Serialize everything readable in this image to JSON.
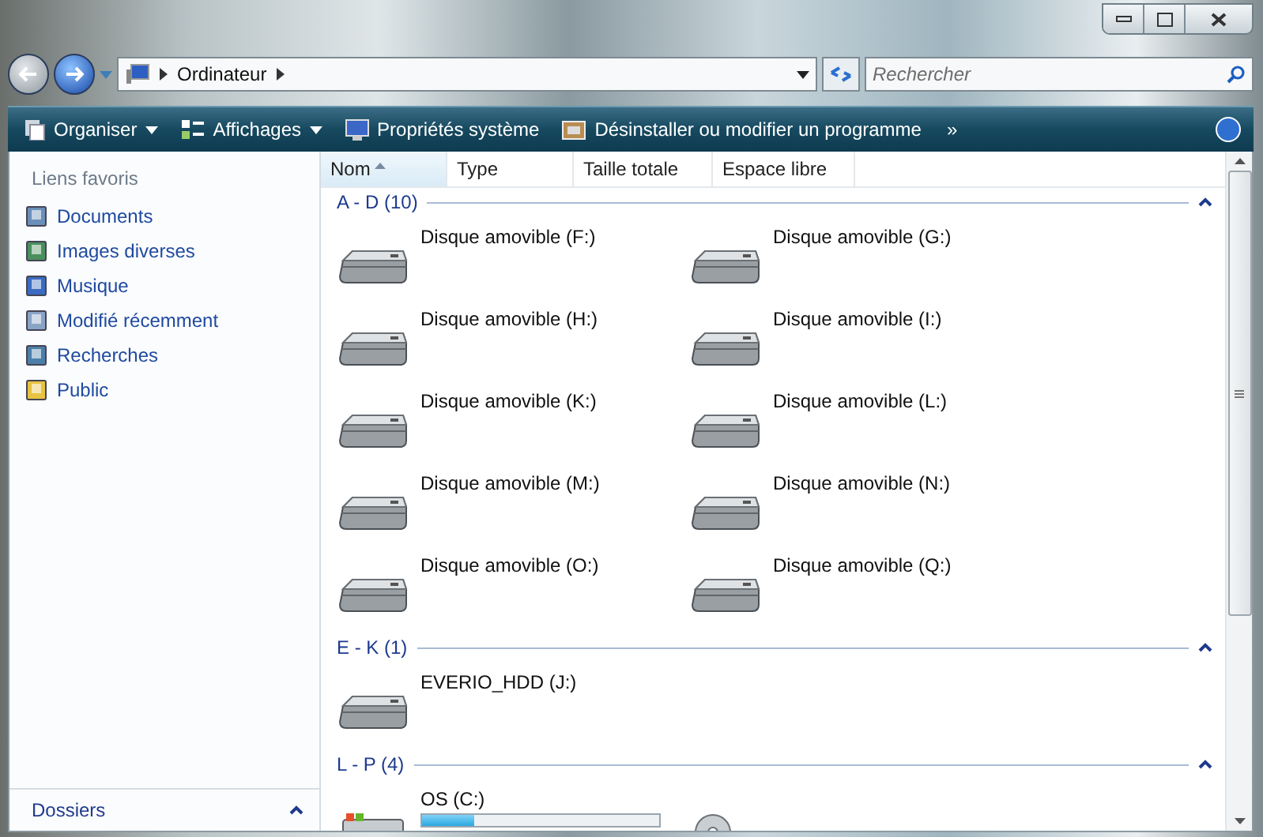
{
  "address": {
    "path": [
      "Ordinateur"
    ]
  },
  "search": {
    "placeholder": "Rechercher"
  },
  "toolbar": [
    {
      "label": "Organiser",
      "kind": "menu"
    },
    {
      "label": "Affichages",
      "kind": "menu"
    },
    {
      "label": "Propriétés système",
      "kind": "plain"
    },
    {
      "label": "Désinstaller ou modifier un programme",
      "kind": "plain"
    }
  ],
  "toolbar_more": "»",
  "sidebar": {
    "title": "Liens favoris",
    "items": [
      {
        "label": "Documents"
      },
      {
        "label": "Images diverses"
      },
      {
        "label": "Musique"
      },
      {
        "label": "Modifié récemment"
      },
      {
        "label": "Recherches"
      },
      {
        "label": "Public"
      }
    ],
    "footer": "Dossiers"
  },
  "columns": [
    {
      "label": "Nom",
      "sorted": true
    },
    {
      "label": "Type",
      "sorted": false
    },
    {
      "label": "Taille totale",
      "sorted": false
    },
    {
      "label": "Espace libre",
      "sorted": false
    }
  ],
  "groups": [
    {
      "title": "A - D (10)",
      "expanded": true,
      "items": [
        {
          "name": "Disque amovible (F:)",
          "kind": "removable"
        },
        {
          "name": "Disque amovible (G:)",
          "kind": "removable"
        },
        {
          "name": "Disque amovible (H:)",
          "kind": "removable"
        },
        {
          "name": "Disque amovible (I:)",
          "kind": "removable"
        },
        {
          "name": "Disque amovible (K:)",
          "kind": "removable"
        },
        {
          "name": "Disque amovible (L:)",
          "kind": "removable"
        },
        {
          "name": "Disque amovible (M:)",
          "kind": "removable"
        },
        {
          "name": "Disque amovible (N:)",
          "kind": "removable"
        },
        {
          "name": "Disque amovible (O:)",
          "kind": "removable"
        },
        {
          "name": "Disque amovible (Q:)",
          "kind": "removable"
        }
      ]
    },
    {
      "title": "E - K (1)",
      "expanded": true,
      "items": [
        {
          "name": "EVERIO_HDD (J:)",
          "kind": "removable"
        }
      ]
    },
    {
      "title": "L - P (4)",
      "expanded": true,
      "items": [
        {
          "name": "OS (C:)",
          "kind": "system",
          "level": 0.22
        },
        {
          "kind": "dvd"
        }
      ]
    }
  ]
}
